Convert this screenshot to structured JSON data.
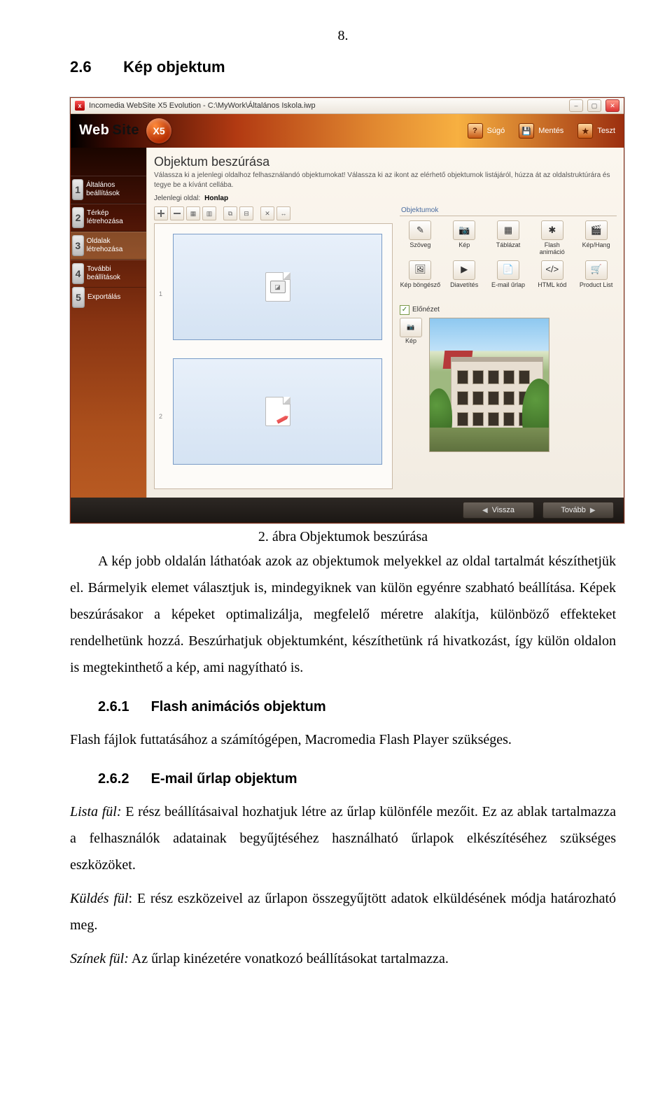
{
  "page_number": "8.",
  "section": {
    "num": "2.6",
    "title": "Kép objektum"
  },
  "screenshot": {
    "window_title": "Incomedia WebSite X5 Evolution - C:\\MyWork\\Általános Iskola.iwp",
    "brand_web": "Web",
    "brand_site": "Site",
    "brand_x5": "X5",
    "top_buttons": {
      "help": "Súgó",
      "save": "Mentés",
      "test": "Teszt"
    },
    "panel_title": "Objektum beszúrása",
    "panel_desc": "Válassza ki a jelenlegi oldalhoz felhasználandó objektumokat! Válassza ki az ikont az elérhető objektumok listájáról, húzza át az oldalstruktúrára és tegye be a kívánt cellába.",
    "current_page_label": "Jelenlegi oldal:",
    "current_page_name": "Honlap",
    "steps": [
      "Általános beállítások",
      "Térkép létrehozása",
      "Oldalak létrehozása",
      "További beállítások",
      "Exportálás"
    ],
    "objects_group": "Objektumok",
    "objects_row1": [
      "Szöveg",
      "Kép",
      "Táblázat",
      "Flash animáció",
      "Kép/Hang"
    ],
    "objects_row2": [
      "Kép böngésző",
      "Diavetítés",
      "E-mail űrlap",
      "HTML kód",
      "Product List"
    ],
    "preview_label": "Előnézet",
    "preview_obj": "Kép",
    "nav_back": "Vissza",
    "nav_next": "Tovább",
    "row1": "1",
    "row2": "2"
  },
  "caption": "2. ábra Objektumok beszúrása",
  "para_intro": "A kép jobb oldalán láthatóak azok az objektumok melyekkel az oldal tartalmát készíthetjük el. Bármelyik elemet választjuk is, mindegyiknek van külön egyénre szabható beállítása. Képek beszúrásakor a képeket optimalizálja, megfelelő méretre alakítja, különböző effekteket rendelhetünk hozzá. Beszúrhatjuk objektumként, készíthetünk rá hivatkozást, így külön oldalon is megtekinthető a kép, ami nagyítható is.",
  "sub1": {
    "num": "2.6.1",
    "title": "Flash animációs objektum"
  },
  "para_sub1": "Flash fájlok futtatásához a számítógépen, Macromedia Flash Player szükséges.",
  "sub2": {
    "num": "2.6.2",
    "title": "E-mail űrlap objektum"
  },
  "para_sub2_lead_label": "Lista fül:",
  "para_sub2_lead_rest": " E rész beállításaival hozhatjuk létre az űrlap különféle mezőit. Ez az ablak tartalmazza a felhasználók adatainak begyűjtéséhez használható űrlapok elkészítéséhez szükséges eszközöket.",
  "para_sub2_send_label": "Küldés fül",
  "para_sub2_send_rest": ": E rész eszközeivel az űrlapon összegyűjtött adatok elküldésének módja határozható meg.",
  "para_sub2_colors_label": "Színek fül:",
  "para_sub2_colors_rest": " Az űrlap kinézetére vonatkozó beállításokat tartalmazza."
}
